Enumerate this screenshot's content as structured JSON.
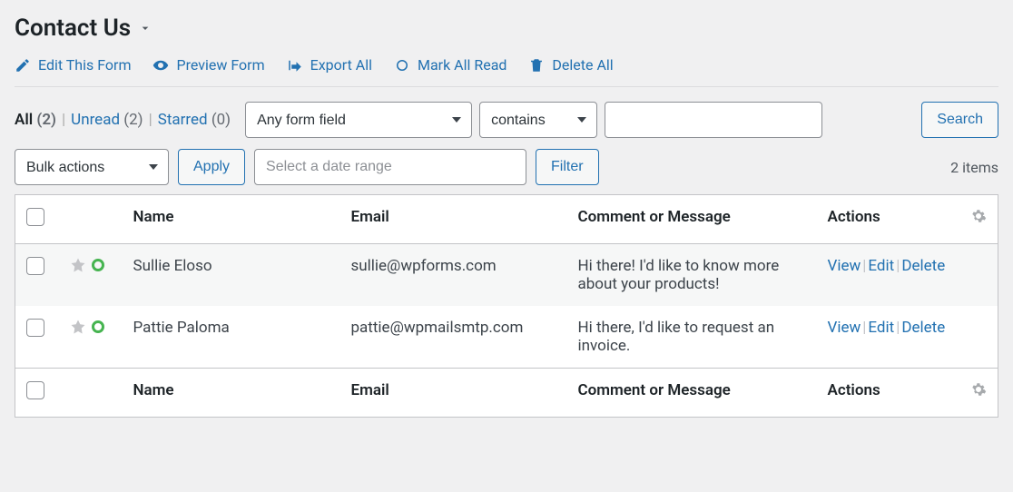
{
  "page_title": "Contact Us",
  "toolbar": {
    "edit": "Edit This Form",
    "preview": "Preview Form",
    "export": "Export All",
    "mark_read": "Mark All Read",
    "delete_all": "Delete All"
  },
  "subsub": {
    "all_label": "All",
    "all_count": "(2)",
    "unread_label": "Unread",
    "unread_count": "(2)",
    "starred_label": "Starred",
    "starred_count": "(0)"
  },
  "filters": {
    "field_select": "Any form field",
    "cond_select": "contains",
    "search_value": "",
    "search_btn": "Search",
    "bulk_select": "Bulk actions",
    "apply_btn": "Apply",
    "date_placeholder": "Select a date range",
    "filter_btn": "Filter"
  },
  "items_count": "2 items",
  "columns": {
    "name": "Name",
    "email": "Email",
    "message": "Comment or Message",
    "actions": "Actions"
  },
  "rows": [
    {
      "name": "Sullie Eloso",
      "email": "sullie@wpforms.com",
      "message": "Hi there! I'd like to know more about your products!"
    },
    {
      "name": "Pattie Paloma",
      "email": "pattie@wpmailsmtp.com",
      "message": "Hi there, I'd like to request an invoice."
    }
  ],
  "row_actions": {
    "view": "View",
    "edit": "Edit",
    "delete": "Delete"
  }
}
